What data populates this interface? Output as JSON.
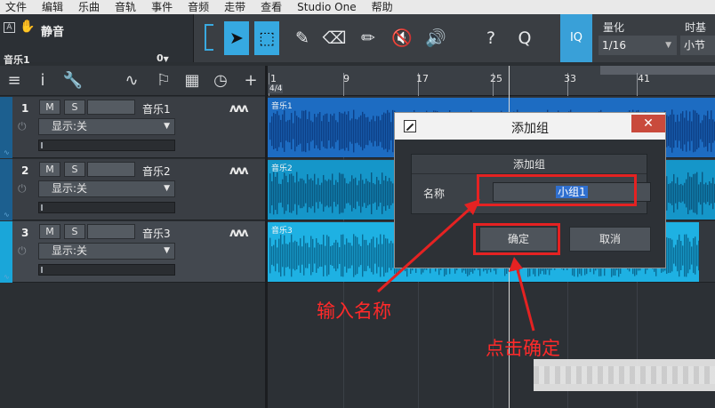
{
  "menu": [
    "文件",
    "编辑",
    "乐曲",
    "音轨",
    "事件",
    "音频",
    "走带",
    "查看",
    "Studio One",
    "帮助"
  ],
  "track_info": {
    "mute_label": "静音",
    "track_name": "音乐1",
    "value": "0"
  },
  "quantize": {
    "label": "量化",
    "value": "1/16"
  },
  "timebase": {
    "label": "时基",
    "value": "小节"
  },
  "iq_label": "IQ",
  "ruler": {
    "ticks": [
      "1",
      "9",
      "17",
      "25",
      "33",
      "41"
    ],
    "time_signature": "4/4"
  },
  "tracks": [
    {
      "number": "1",
      "name": "音乐1",
      "mute": "M",
      "solo": "S",
      "display": "显示:关",
      "clip": "音乐1"
    },
    {
      "number": "2",
      "name": "音乐2",
      "mute": "M",
      "solo": "S",
      "display": "显示:关",
      "clip": "音乐2"
    },
    {
      "number": "3",
      "name": "音乐3",
      "mute": "M",
      "solo": "S",
      "display": "显示:关",
      "clip": "音乐3"
    }
  ],
  "dialog": {
    "title": "添加组",
    "panel_title": "添加组",
    "name_label": "名称",
    "name_value": "小组1",
    "ok_label": "确定",
    "cancel_label": "取消"
  },
  "annotations": {
    "enter_name": "输入名称",
    "click_ok": "点击确定",
    "highlight_color": "#e52222"
  },
  "colors": {
    "accent": "#36a9e1",
    "clip_blue": "#1f6fc4",
    "clip_cyan": "#17a9d8"
  }
}
